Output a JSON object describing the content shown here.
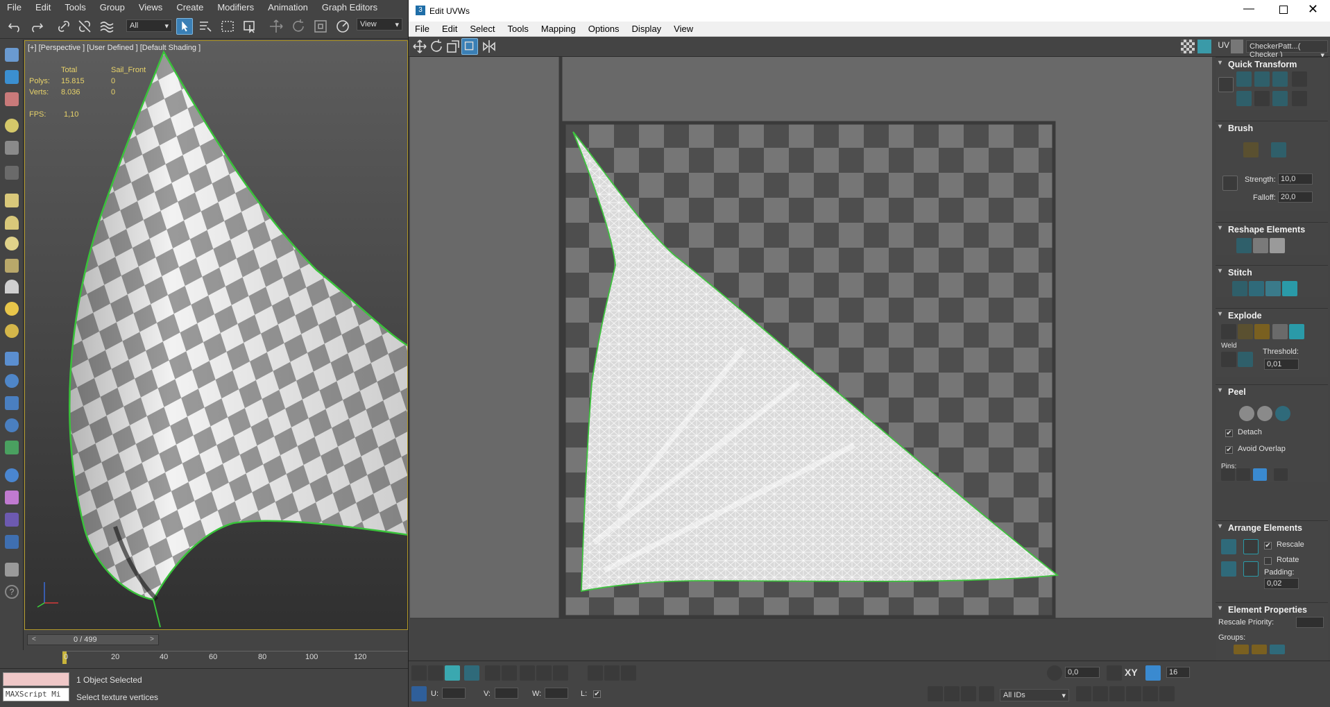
{
  "main_menu": [
    "File",
    "Edit",
    "Tools",
    "Group",
    "Views",
    "Create",
    "Modifiers",
    "Animation",
    "Graph Editors"
  ],
  "main_toolbar": {
    "selection_filter": "All",
    "ref_coord": "View"
  },
  "viewport": {
    "label": "[+] [Perspective ] [User Defined ] [Default Shading ]",
    "stats_header_total": "Total",
    "stats_header_object": "Sail_Front",
    "polys_label": "Polys:",
    "polys_total": "15.815",
    "polys_obj": "0",
    "verts_label": "Verts:",
    "verts_total": "8.036",
    "verts_obj": "0",
    "fps_label": "FPS:",
    "fps_value": "1,10"
  },
  "timeline": {
    "frame": "0 / 499",
    "ticks": [
      "0",
      "20",
      "40",
      "60",
      "80",
      "100",
      "120"
    ]
  },
  "status": {
    "maxscript": "MAXScript Mi",
    "selected": "1 Object Selected",
    "prompt": "Select texture vertices"
  },
  "uv_window": {
    "title": "Edit UVWs",
    "menu": [
      "File",
      "Edit",
      "Select",
      "Tools",
      "Mapping",
      "Options",
      "Display",
      "View"
    ],
    "uv_label": "UV",
    "texture_dropdown": "CheckerPatt...( Checker )"
  },
  "panel": {
    "quick_transform": "Quick Transform",
    "brush": "Brush",
    "strength_label": "Strength:",
    "strength": "10,0",
    "falloff_label": "Falloff:",
    "falloff": "20,0",
    "reshape": "Reshape Elements",
    "stitch": "Stitch",
    "explode": "Explode",
    "weld": "Weld",
    "threshold_label": "Threshold:",
    "threshold": "0,01",
    "peel": "Peel",
    "detach": "Detach",
    "avoid_overlap": "Avoid Overlap",
    "pins": "Pins:",
    "arrange": "Arrange Elements",
    "rescale": "Rescale",
    "rotate": "Rotate",
    "padding_label": "Padding:",
    "padding": "0,02",
    "element_props": "Element Properties",
    "rescale_priority": "Rescale Priority:",
    "groups": "Groups:"
  },
  "bottom": {
    "u_label": "U:",
    "v_label": "V:",
    "w_label": "W:",
    "l_label": "L:",
    "angle": "0,0",
    "xy": "XY",
    "zoom": "16",
    "ids": "All IDs"
  }
}
